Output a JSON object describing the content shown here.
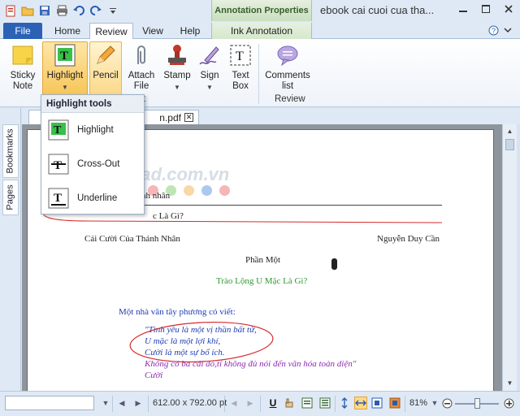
{
  "window": {
    "context_tab_group": "Annotation Properties",
    "document_title": "ebook cai cuoi cua tha..."
  },
  "tabs": [
    {
      "label": "File"
    },
    {
      "label": "Home"
    },
    {
      "label": "Review"
    },
    {
      "label": "View"
    },
    {
      "label": "Help"
    },
    {
      "label": "Ink Annotation"
    }
  ],
  "ribbon": {
    "buttons": [
      {
        "label": "Sticky\nNote",
        "icon": "sticky-note-icon"
      },
      {
        "label": "Highlight",
        "icon": "highlight-icon"
      },
      {
        "label": "Pencil",
        "icon": "pencil-icon"
      },
      {
        "label": "Attach\nFile",
        "icon": "paperclip-icon"
      },
      {
        "label": "Stamp",
        "icon": "stamp-icon"
      },
      {
        "label": "Sign",
        "icon": "pen-sign-icon"
      },
      {
        "label": "Text\nBox",
        "icon": "text-box-icon"
      },
      {
        "label": "Comments\nlist",
        "icon": "comment-icon"
      }
    ],
    "group_labels": {
      "annotate_partial": "t",
      "review": "Review"
    }
  },
  "dropdown": {
    "header": "Highlight tools",
    "items": [
      {
        "label": "Highlight",
        "icon": "highlight-tool-icon"
      },
      {
        "label": "Cross-Out",
        "icon": "cross-out-icon"
      },
      {
        "label": "Underline",
        "icon": "underline-icon"
      }
    ]
  },
  "sidebar": {
    "bookmarks": "Bookmarks",
    "pages": "Pages"
  },
  "document_tab": {
    "visible_name": "n.pdf"
  },
  "page": {
    "watermark": "Download.com.vn",
    "header_partial_1": "nh nhân",
    "header_partial_2": "c Là Gì?",
    "running_left": "Cái Cười Của Thánh Nhân",
    "running_right": "Nguyễn Duy Cần",
    "part_title": "Phần Một",
    "chapter_title": "Trào Lộng U Mặc Là Gì?",
    "intro": "Một nhà văn tây phương có viết:",
    "quote": [
      "\"Tình yêu là một vị thần bất tử,",
      "U mặc là một lợi khí,",
      "Cười là một sự bổ ích.",
      "Không có ba cái đó,tí không đủ nói  đến văn hóa toàn diện\"",
      "Cười"
    ]
  },
  "statusbar": {
    "page_size": "612.00 x 792.00 pt",
    "zoom": "81%"
  },
  "colors": {
    "file_tab": "#2b62b6",
    "pressed": "#f7c65a",
    "ink_red": "#d62a2a",
    "green_text": "#2e9a2e",
    "blue_text": "#1f3fb3",
    "purple_text": "#8e2bb0"
  }
}
